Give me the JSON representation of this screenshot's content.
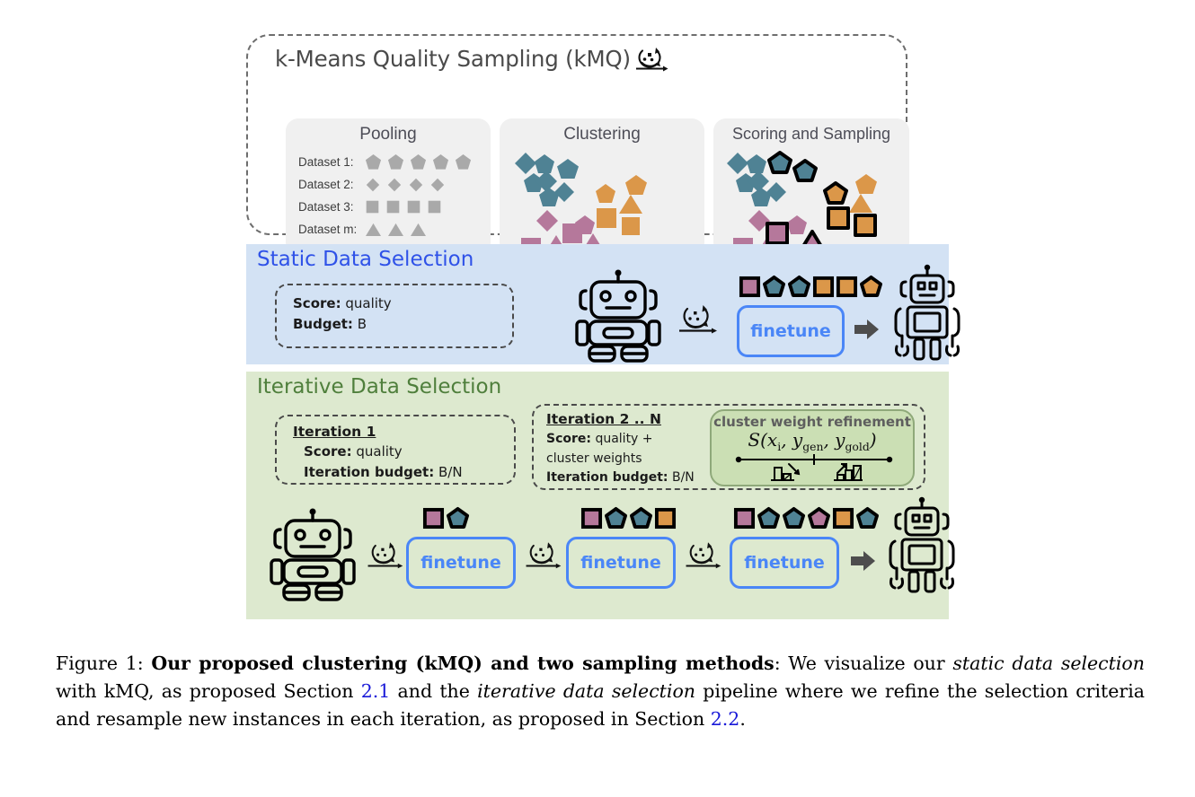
{
  "figure": {
    "kmq": {
      "title": "k-Means Quality Sampling (kMQ)",
      "icon": "cluster-cycle-icon",
      "stages": [
        {
          "id": "pooling",
          "title": "Pooling",
          "rows": [
            {
              "label": "Dataset 1:",
              "shape": "pentagon",
              "count": 5,
              "color": "#a9a9a9"
            },
            {
              "label": "Dataset 2:",
              "shape": "diamond",
              "count": 4,
              "color": "#a9a9a9"
            },
            {
              "label": "Dataset 3:",
              "shape": "square",
              "count": 4,
              "color": "#a9a9a9"
            },
            {
              "label": "Dataset m:",
              "shape": "triangle",
              "count": 3,
              "color": "#a9a9a9"
            }
          ]
        },
        {
          "id": "clustering",
          "title": "Clustering"
        },
        {
          "id": "scoring",
          "title": "Scoring and Sampling"
        }
      ]
    },
    "static": {
      "heading": "Static Data Selection",
      "info": [
        {
          "key": "Score:",
          "value": " quality"
        },
        {
          "key": "Budget:",
          "value": " B"
        }
      ],
      "finetune_label": "finetune",
      "tokens": [
        "square-pink",
        "pentagon-teal",
        "pentagon-teal",
        "square-orange",
        "square-orange",
        "pentagon-orange"
      ]
    },
    "iterative": {
      "heading": "Iterative Data Selection",
      "iteration1": {
        "title": "Iteration 1",
        "lines": [
          {
            "key": "Score:",
            "value": " quality"
          },
          {
            "key": "Iteration budget:",
            "value": " B/N"
          }
        ]
      },
      "iteration2n": {
        "title": "Iteration 2 .. N",
        "lines": [
          {
            "key": "Score:",
            "value": " quality +"
          },
          {
            "key": "",
            "value": "cluster weights"
          },
          {
            "key": "Iteration budget:",
            "value": " B/N"
          }
        ]
      },
      "cluster_weight_refinement": {
        "title": "cluster weight refinement",
        "formula_main": "S(x",
        "formula_sub1": "i",
        "formula_mid": ", y",
        "formula_sub2": "gen",
        "formula_mid2": ", y",
        "formula_sub3": "gold",
        "formula_end": ")",
        "axis_left_icon": "bar-chart-down-icon",
        "axis_right_icon": "bar-chart-up-icon"
      },
      "finetune_label": "finetune",
      "stages": [
        {
          "tokens": [
            "square-pink",
            "pentagon-teal"
          ]
        },
        {
          "tokens": [
            "square-pink",
            "pentagon-teal",
            "pentagon-teal",
            "square-orange"
          ]
        },
        {
          "tokens": [
            "square-pink",
            "pentagon-teal",
            "pentagon-teal",
            "pentagon-pink",
            "square-orange",
            "pentagon-teal"
          ]
        }
      ]
    },
    "colors": {
      "teal": "#4f8294",
      "orange": "#db9749",
      "pink": "#b5789b",
      "gray_shape": "#a9a9a9",
      "static_panel_bg": "#d3e2f4",
      "static_heading": "#2f52e8",
      "iter_panel_bg": "#dde9cf",
      "iter_heading": "#4f7f3c",
      "finetune_blue": "#4a86f7",
      "cwr_bg": "#cbdfb4",
      "stage_card_bg": "#f0f0f0"
    }
  },
  "caption": {
    "label": "Figure 1:",
    "bold_part": "Our proposed clustering (kMQ) and two sampling methods",
    "rest_1": ": We visualize our ",
    "italic_1": "static data selection",
    "rest_2": " with kMQ, as proposed Section ",
    "link_1": "2.1",
    "rest_3": " and the ",
    "italic_2": "iterative data selection",
    "rest_4": " pipeline where we refine the selection criteria and resample new instances in each iteration, as proposed in Section ",
    "link_2": "2.2",
    "rest_5": "."
  }
}
